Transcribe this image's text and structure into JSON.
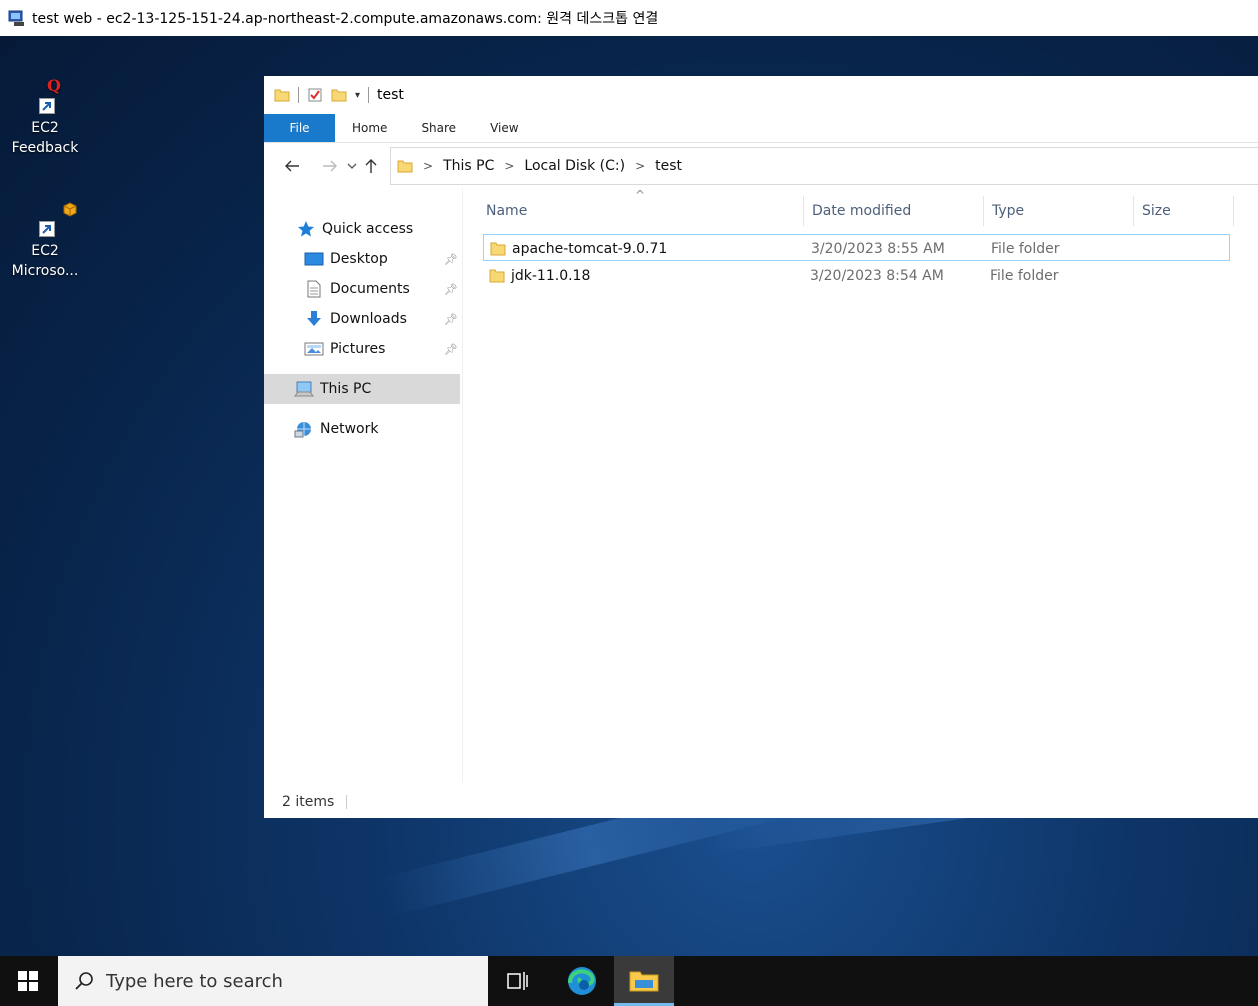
{
  "rdp": {
    "title": "test web - ec2-13-125-151-24.ap-northeast-2.compute.amazonaws.com: 원격 데스크톱 연결"
  },
  "desktop": {
    "icons": [
      {
        "label_line1": "EC2",
        "label_line2": "Feedback",
        "icon": "feedback-q-icon"
      },
      {
        "label_line1": "EC2",
        "label_line2": "Microso...",
        "icon": "package-icon"
      }
    ]
  },
  "explorer": {
    "window_title": "test",
    "ribbon_tabs": [
      "File",
      "Home",
      "Share",
      "View"
    ],
    "breadcrumb": [
      "This PC",
      "Local Disk (C:)",
      "test"
    ],
    "nav": {
      "quick_access": "Quick access",
      "items": [
        {
          "label": "Desktop",
          "pinned": true
        },
        {
          "label": "Documents",
          "pinned": true
        },
        {
          "label": "Downloads",
          "pinned": true
        },
        {
          "label": "Pictures",
          "pinned": true
        }
      ],
      "this_pc": "This PC",
      "network": "Network"
    },
    "columns": [
      "Name",
      "Date modified",
      "Type",
      "Size"
    ],
    "files": [
      {
        "name": "apache-tomcat-9.0.71",
        "date": "3/20/2023 8:55 AM",
        "type": "File folder",
        "size": ""
      },
      {
        "name": "jdk-11.0.18",
        "date": "3/20/2023 8:54 AM",
        "type": "File folder",
        "size": ""
      }
    ],
    "status": "2 items"
  },
  "taskbar": {
    "search_placeholder": "Type here to search"
  },
  "colors": {
    "accent": "#1979ca",
    "folder": "#f8d775",
    "selection": "#99d1ff"
  }
}
